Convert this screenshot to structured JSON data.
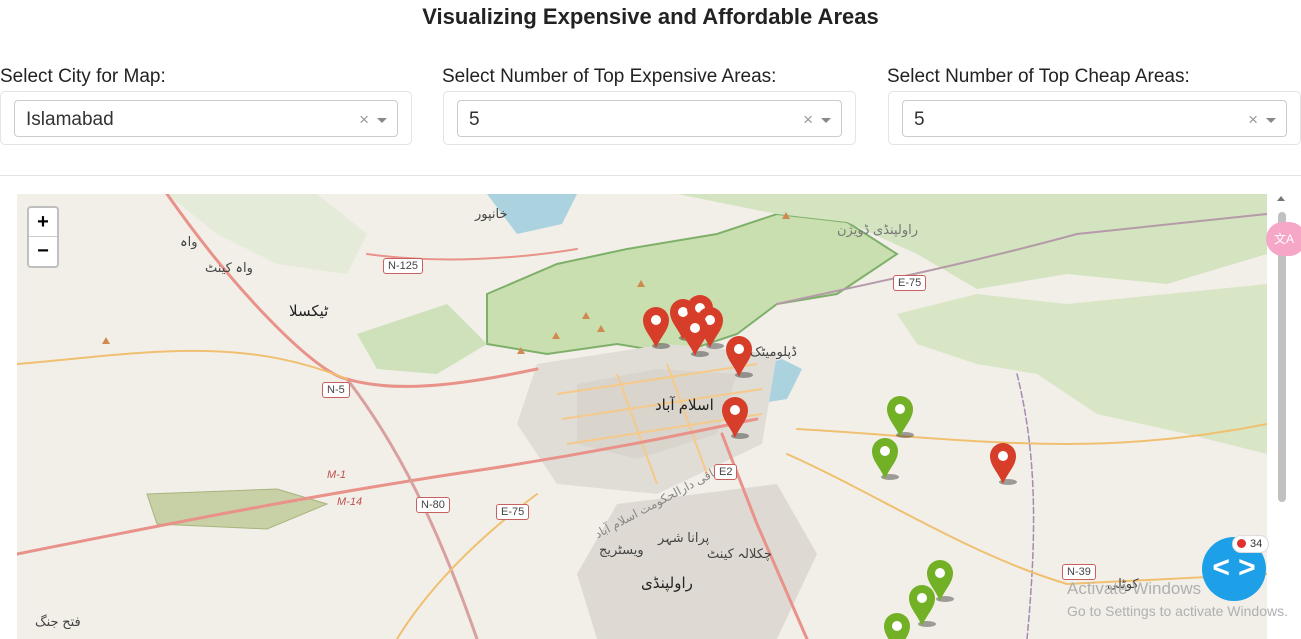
{
  "page": {
    "title": "Visualizing Expensive and Affordable Areas"
  },
  "filters": [
    {
      "label": "Select City for Map:",
      "value": "Islamabad",
      "clear": "×"
    },
    {
      "label": "Select Number of Top Expensive Areas:",
      "value": "5",
      "clear": "×"
    },
    {
      "label": "Select Number of Top Cheap Areas:",
      "value": "5",
      "clear": "×"
    }
  ],
  "map": {
    "zoom_in": "+",
    "zoom_out": "−",
    "places": {
      "wah": "واہ",
      "wah_cantt": "واہ کینٹ",
      "taxila": "ٹیکسلا",
      "islamabad": "اسلام آباد",
      "rawalpindi": "راولپنڈی",
      "khanpur": "خانپور",
      "diplomatic": "ڈپلومیٹک",
      "rawalpindi_cantt": "چکلالہ کینٹ",
      "purana_shehr": "پرانا شہر",
      "westridge": "ویسٹریج",
      "fateh_jang": "فتح جنگ",
      "kotli": "کوٹلی",
      "rawalpindi_division": "راولپنڈی ڈویژن",
      "federal_capital": "وفاقی دارالحکومت اسلام آباد"
    },
    "roads": [
      "N-125",
      "E-75",
      "N-5",
      "M-1",
      "M-14",
      "N-80",
      "E-75",
      "E2",
      "N-39"
    ],
    "expensive_color": "#d63e2a",
    "cheap_color": "#72b026"
  },
  "overlay": {
    "badge_count": "34",
    "dev_button": "< >",
    "activate_title": "Activate Windows",
    "activate_sub": "Go to Settings to activate Windows.",
    "translate": "文A"
  }
}
